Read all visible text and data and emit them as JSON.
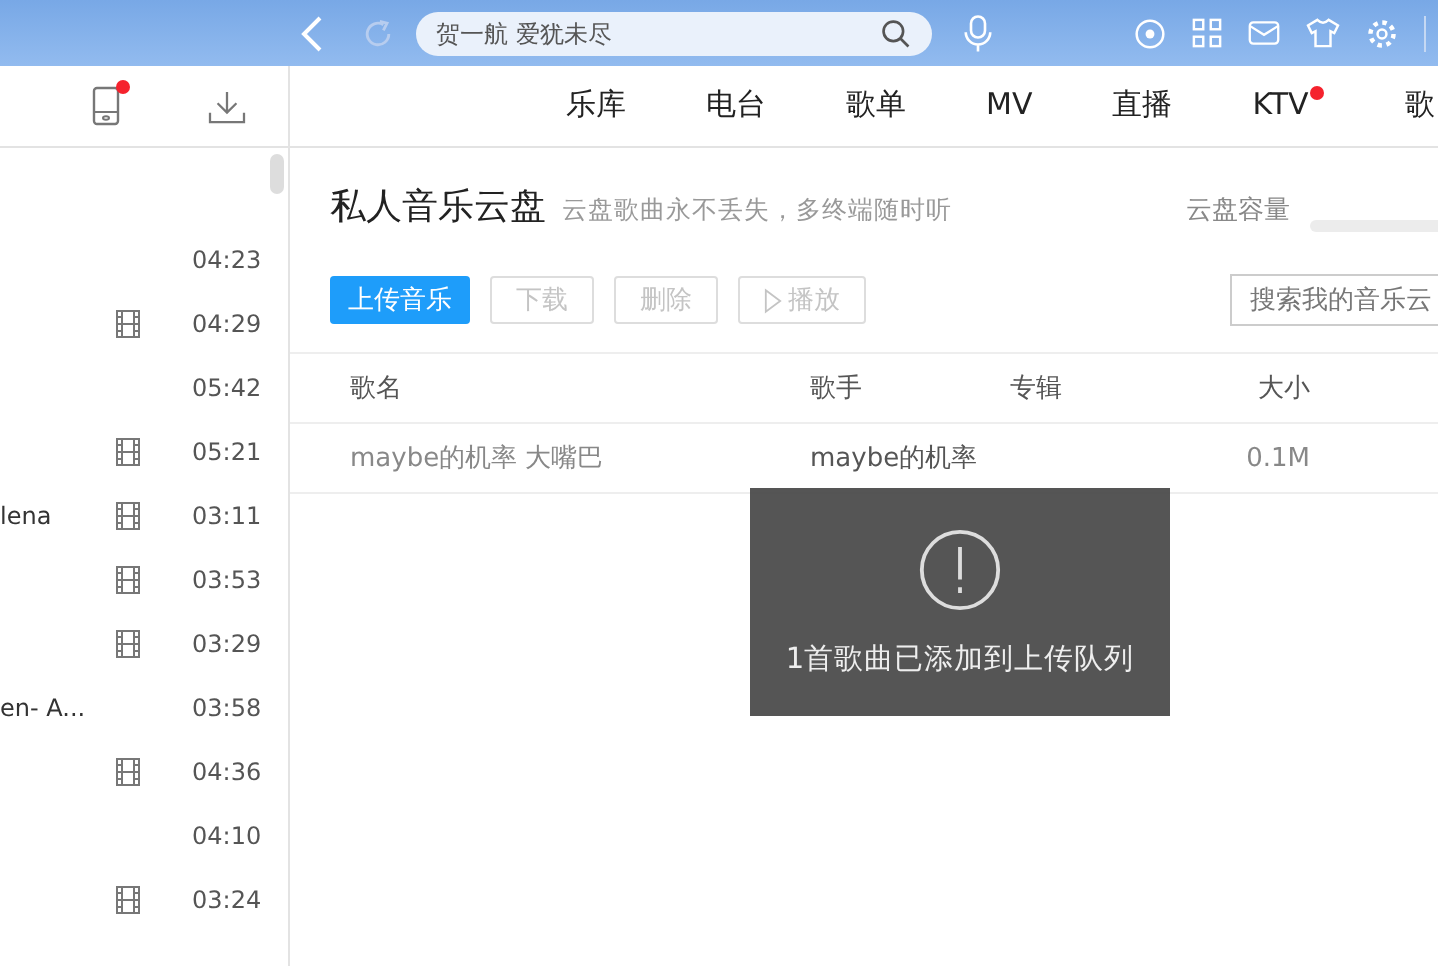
{
  "top_bar": {
    "search": {
      "placeholder": "贺一航 爱犹未尽"
    }
  },
  "nav_tabs": [
    {
      "label": "乐库",
      "badge": false
    },
    {
      "label": "电台",
      "badge": false
    },
    {
      "label": "歌单",
      "badge": false
    },
    {
      "label": "MV",
      "badge": false
    },
    {
      "label": "直播",
      "badge": false
    },
    {
      "label": "KTV",
      "badge": true
    },
    {
      "label": "歌",
      "badge": false
    }
  ],
  "sidebar": {
    "device_badge": true,
    "songs": [
      {
        "mv": false,
        "duration": "04:23"
      },
      {
        "mv": true,
        "duration": "04:29"
      },
      {
        "mv": false,
        "duration": "05:42"
      },
      {
        "mv": true,
        "duration": "05:21"
      },
      {
        "title": "lena",
        "mv": true,
        "duration": "03:11"
      },
      {
        "mv": true,
        "duration": "03:53"
      },
      {
        "mv": true,
        "duration": "03:29"
      },
      {
        "title": "en- A...",
        "mv": false,
        "duration": "03:58"
      },
      {
        "mv": true,
        "duration": "04:36"
      },
      {
        "mv": false,
        "duration": "04:10"
      },
      {
        "mv": true,
        "duration": "03:24"
      }
    ]
  },
  "cloud": {
    "title": "私人音乐云盘",
    "subtitle": "云盘歌曲永不丢失，多终端随时听",
    "capacity_label": "云盘容量",
    "buttons": [
      {
        "label": "上传音乐",
        "kind": "primary",
        "disabled": false
      },
      {
        "label": "下载",
        "kind": "plain",
        "disabled": true
      },
      {
        "label": "删除",
        "kind": "plain",
        "disabled": true
      },
      {
        "label": "播放",
        "kind": "play",
        "disabled": true
      }
    ],
    "search": {
      "placeholder": "搜索我的音乐云"
    },
    "table": {
      "columns": [
        "歌名",
        "歌手",
        "专辑",
        "大小"
      ],
      "rows": [
        [
          "maybe的机率 大嘴巴",
          "maybe的机率",
          "",
          "0.1M"
        ]
      ]
    }
  },
  "toast": {
    "message": "1首歌曲已添加到上传队列"
  }
}
